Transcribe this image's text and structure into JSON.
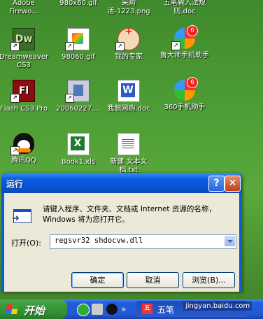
{
  "desktop": {
    "top_row": [
      "Adobe Firewo...",
      "980x60.gif",
      "采购活-1223.png",
      "五笔输入法规则.doc"
    ],
    "icons": [
      {
        "label": "Dreamweaver CS3",
        "icon": "dreamweaver-icon"
      },
      {
        "label": "98060.gif",
        "icon": "image-file-icon"
      },
      {
        "label": "我的专家",
        "icon": "expert-icon"
      },
      {
        "label": "鲁大师手机助手",
        "icon": "ludashi-icon"
      },
      {
        "label": "Flash CS3 Pro",
        "icon": "flash-icon"
      },
      {
        "label": "20060227....",
        "icon": "setup-icon"
      },
      {
        "label": "我想网购.doc",
        "icon": "word-doc-icon"
      },
      {
        "label": "360手机助手",
        "icon": "360-icon"
      },
      {
        "label": "腾讯QQ",
        "icon": "qq-icon"
      },
      {
        "label": "Book1.xls",
        "icon": "excel-icon"
      },
      {
        "label": "新建 文本文档.txt",
        "icon": "text-file-icon"
      }
    ]
  },
  "dialog": {
    "title": "运行",
    "help": "?",
    "close": "✕",
    "description": "请键入程序、文件夹、文档或 Internet 资源的名称，Windows 将为您打开它。",
    "open_label": "打开(O):",
    "open_value": "regsvr32 shdocvw.dll",
    "ok": "确定",
    "cancel": "取消",
    "browse": "浏览(B)..."
  },
  "taskbar": {
    "start": "开始",
    "task_label": "五笔",
    "task_icon_text": "五"
  },
  "watermark": "jingyan.baidu.com"
}
